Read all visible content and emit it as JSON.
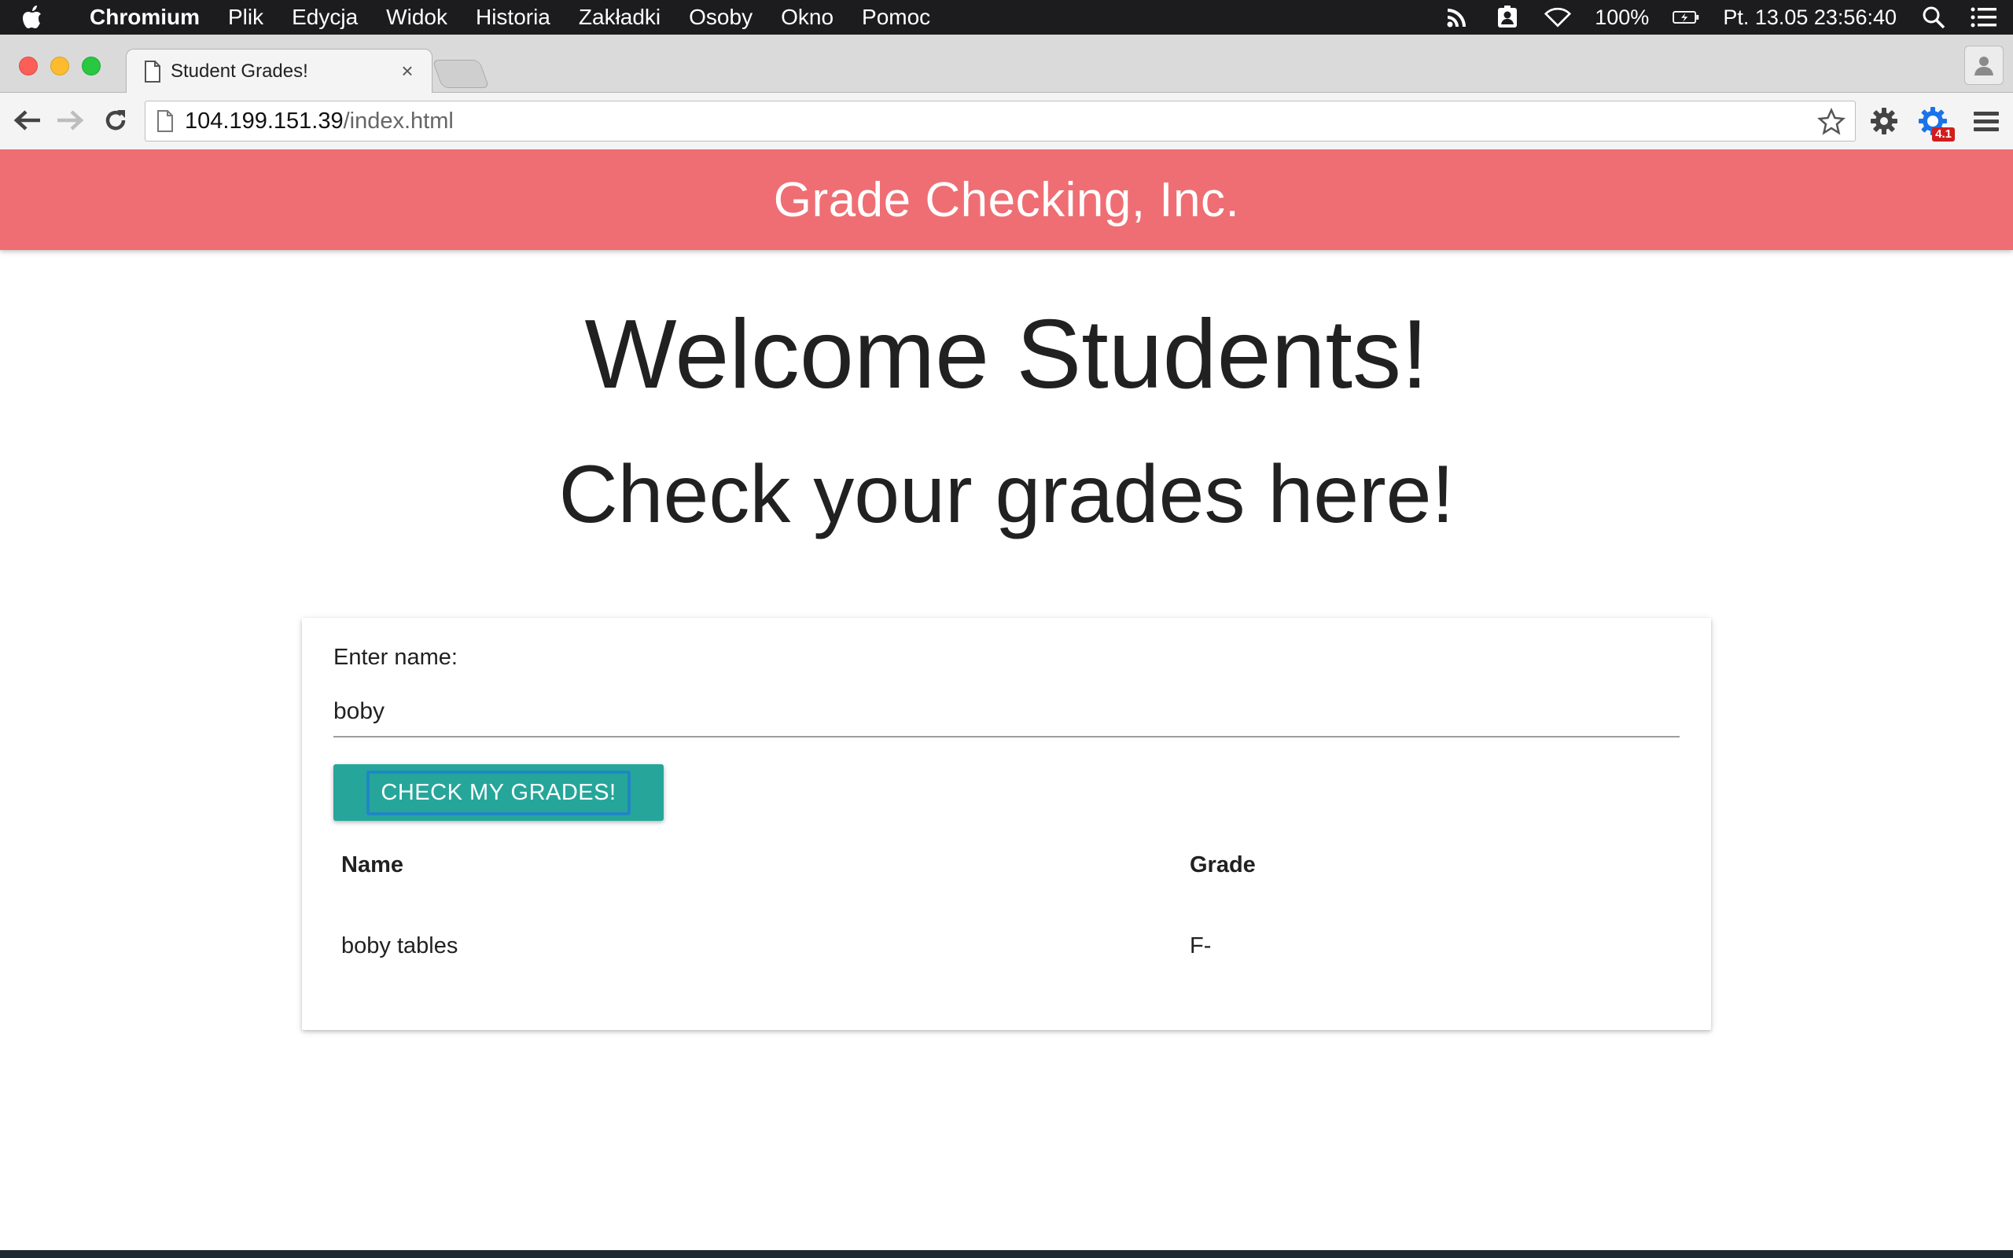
{
  "menubar": {
    "app_name": "Chromium",
    "menus": [
      "Plik",
      "Edycja",
      "Widok",
      "Historia",
      "Zakładki",
      "Osoby",
      "Okno",
      "Pomoc"
    ],
    "battery": "100%",
    "datetime": "Pt. 13.05  23:56:40"
  },
  "browser": {
    "tab_title": "Student Grades!",
    "tab_close": "×",
    "url_host": "104.199.151.39",
    "url_path": "/index.html",
    "extension_badge": "4.1"
  },
  "page": {
    "brand": "Grade Checking, Inc.",
    "welcome": "Welcome Students!",
    "subtitle": "Check your grades here!",
    "form": {
      "label": "Enter name:",
      "value": "boby",
      "button": "CHECK MY GRADES!"
    },
    "table": {
      "headers": [
        "Name",
        "Grade"
      ],
      "rows": [
        [
          "boby tables",
          "F-"
        ]
      ]
    }
  },
  "colors": {
    "header": "#ef6e73",
    "button": "#26a69a",
    "button_focus_ring": "#1f87c4"
  }
}
